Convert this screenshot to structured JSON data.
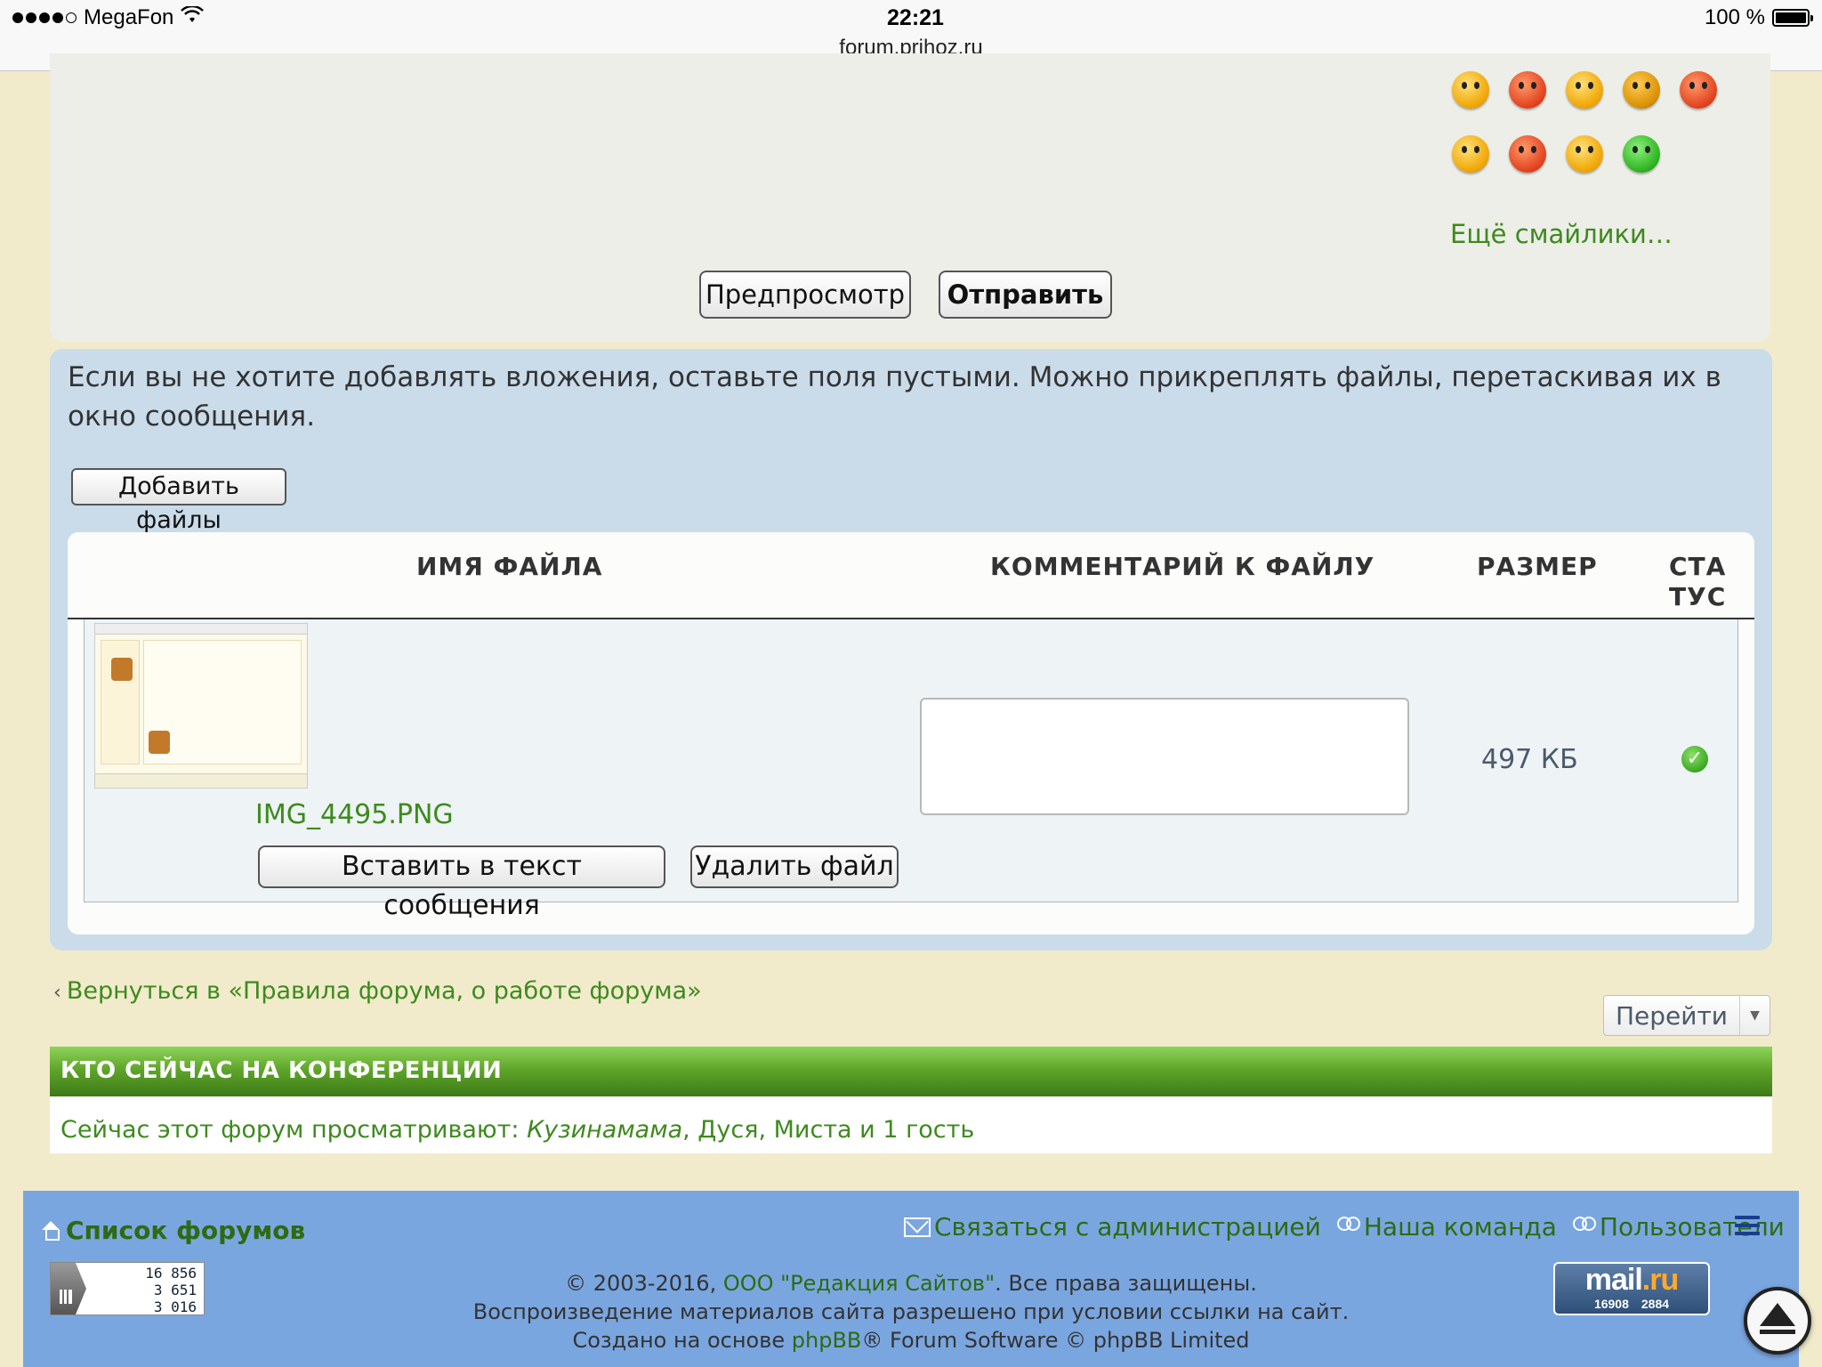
{
  "status_bar": {
    "carrier": "MegaFon",
    "time": "22:21",
    "battery": "100 %",
    "url": "forum.prihoz.ru"
  },
  "smilies": {
    "rows": [
      [
        "surprised-smiley-icon",
        "shouting-smiley-icon",
        "whistling-smiley-icon",
        "cool-sunglasses-smiley-icon",
        "angry-smiley-icon"
      ],
      [
        "smile-smiley-icon",
        "boxing-smiley-icon",
        "thinking-smiley-icon",
        "sick-smiley-icon"
      ]
    ],
    "more_label": "Ещё смайлики…"
  },
  "actions": {
    "preview_label": "Предпросмотр",
    "submit_label": "Отправить"
  },
  "attachments": {
    "info": "Если вы не хотите добавлять вложения, оставьте поля пустыми. Можно прикреплять файлы, перетаскивая их в окно сообщения.",
    "add_files_label": "Добавить файлы",
    "columns": {
      "name": "ИМЯ ФАЙЛА",
      "comment": "КОММЕНТАРИЙ К ФАЙЛУ",
      "size": "РАЗМЕР",
      "status_line1": "СТА",
      "status_line2": "ТУС"
    },
    "file": {
      "name": "IMG_4495.PNG",
      "size": "497 КБ",
      "comment": "",
      "insert_label": "Вставить в текст сообщения",
      "delete_label": "Удалить файл",
      "status_icon": "check-circle-icon"
    }
  },
  "navigation": {
    "return_link": "Вернуться в «Правила форума, о работе форума»",
    "jump_label": "Перейти"
  },
  "online": {
    "title": "КТО СЕЙЧАС НА КОНФЕРЕНЦИИ",
    "prefix": "Сейчас этот форум просматривают: ",
    "user1": "Кузинамама",
    "rest": ", Дуся, Миста и 1 гость"
  },
  "footer": {
    "home_link": "Список форумов",
    "contact_link": "Связаться с администрацией",
    "team_link": "Наша команда",
    "users_link": "Пользователи",
    "counter": [
      "16 856",
      "3 651",
      "3 016"
    ],
    "copyright_pre": "© 2003-2016, ",
    "copyright_company": "ООО \"Редакция Сайтов\"",
    "copyright_post": ". Все права защищены.",
    "line2": "Воспроизведение материалов сайта разрешено при условии ссылки на сайт.",
    "line3_pre": "Создано на основе ",
    "line3_link": "phpBB",
    "line3_post": "® Forum Software © phpBB Limited",
    "mailru_logo_1": "mail",
    "mailru_logo_2": ".ru",
    "mailru_stats": [
      "16908",
      "2884"
    ]
  },
  "colors": {
    "page_bg": "#f1ebcb",
    "link_green": "#3e8a1e",
    "attach_panel": "#cadcea",
    "footer_blue": "#7aa6e0",
    "header_green": "#5fa62a"
  }
}
